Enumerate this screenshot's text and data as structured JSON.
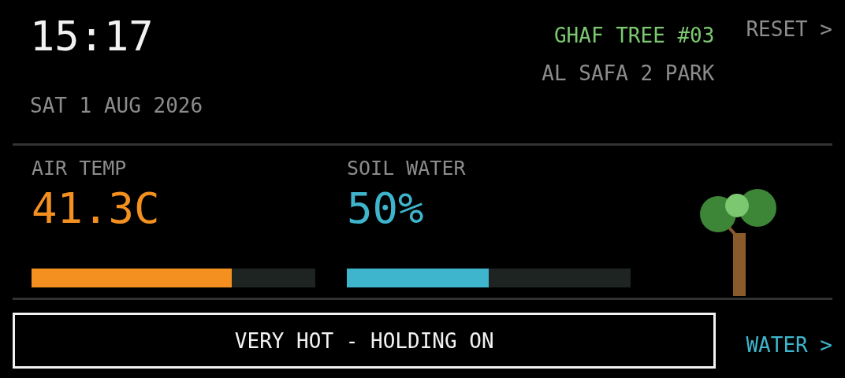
{
  "clock": {
    "time": "15:17",
    "date": "SAT 1 AUG 2026"
  },
  "tree": {
    "name": "GHAF TREE #03",
    "location": "AL SAFA 2 PARK"
  },
  "reset_button": {
    "label": "RESET >"
  },
  "readings": [
    {
      "label": "AIR TEMP",
      "value": "41.3C",
      "color": "#f39020",
      "level": 0.705
    },
    {
      "label": "SOIL WATER",
      "value": "50%",
      "color": "#3eb5cc",
      "level": 0.5
    }
  ],
  "status": {
    "message": "VERY HOT - HOLDING ON"
  },
  "water_button": {
    "label": "WATER >"
  }
}
